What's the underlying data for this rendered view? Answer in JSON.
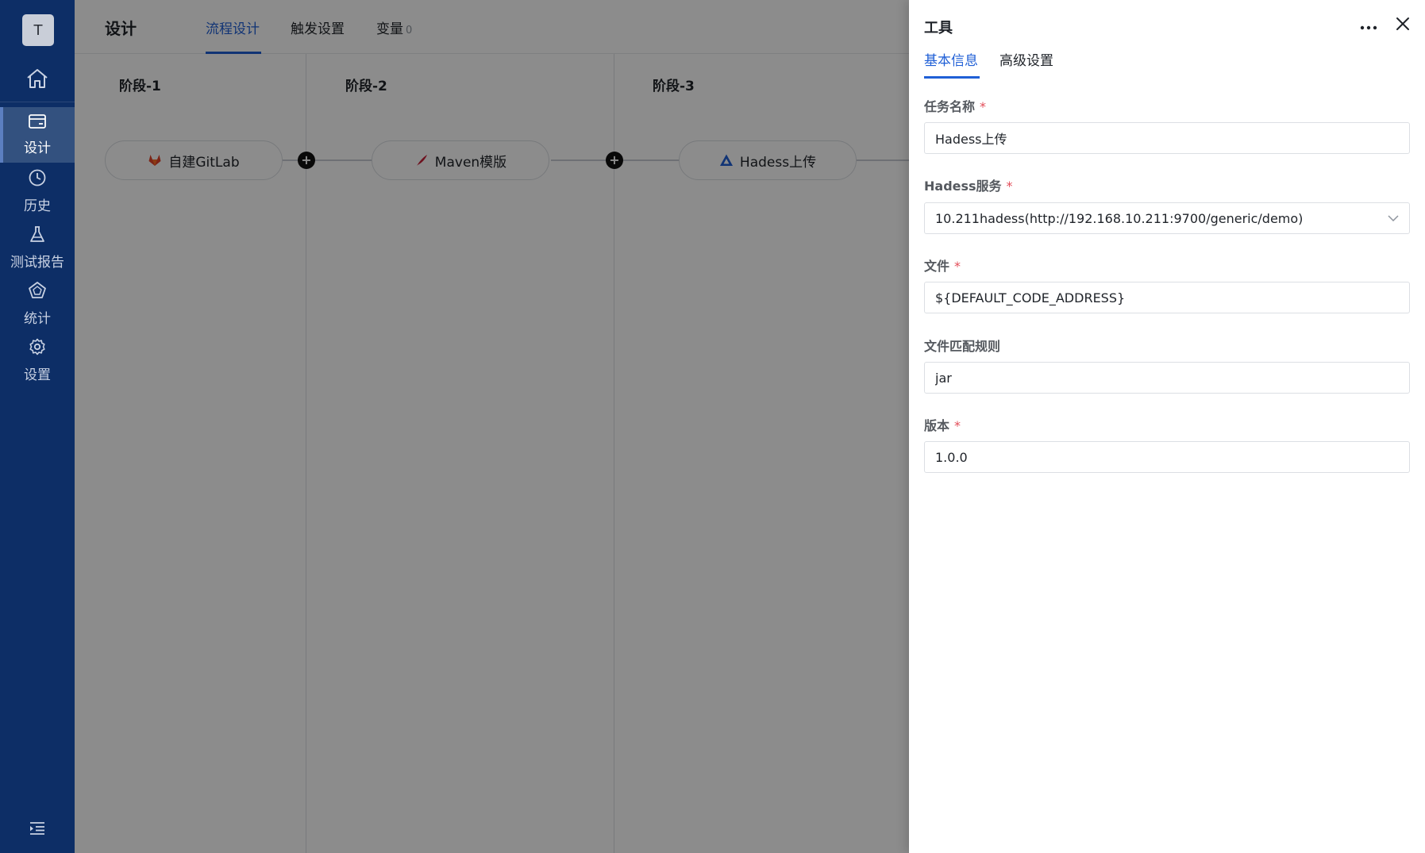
{
  "sidebar": {
    "avatar": "T",
    "items": [
      {
        "label": "设计"
      },
      {
        "label": "历史"
      },
      {
        "label": "测试报告"
      },
      {
        "label": "统计"
      },
      {
        "label": "设置"
      }
    ]
  },
  "header": {
    "title": "设计",
    "tabs": [
      {
        "label": "流程设计"
      },
      {
        "label": "触发设置"
      },
      {
        "label": "变量"
      }
    ],
    "variable_count": "0"
  },
  "pipeline": {
    "stages": [
      {
        "title": "阶段-1",
        "task": "自建GitLab"
      },
      {
        "title": "阶段-2",
        "task": "Maven模版"
      },
      {
        "title": "阶段-3",
        "task": "Hadess上传"
      }
    ],
    "plus_symbol": "+"
  },
  "drawer": {
    "title": "工具",
    "tabs": [
      {
        "label": "基本信息"
      },
      {
        "label": "高级设置"
      }
    ],
    "required_mark": "*",
    "fields": {
      "task_name": {
        "label": "任务名称",
        "value": "Hadess上传"
      },
      "hadess_service": {
        "label": "Hadess服务",
        "value": "10.211hadess(http://192.168.10.211:9700/generic/demo)"
      },
      "file": {
        "label": "文件",
        "value": "${DEFAULT_CODE_ADDRESS}"
      },
      "file_match_rule": {
        "label": "文件匹配规则",
        "value": "jar"
      },
      "version": {
        "label": "版本",
        "value": "1.0.0"
      }
    }
  },
  "colors": {
    "sidebar_bg": "#0d2e66",
    "accent": "#1f5fd6",
    "required": "#e34d59"
  }
}
